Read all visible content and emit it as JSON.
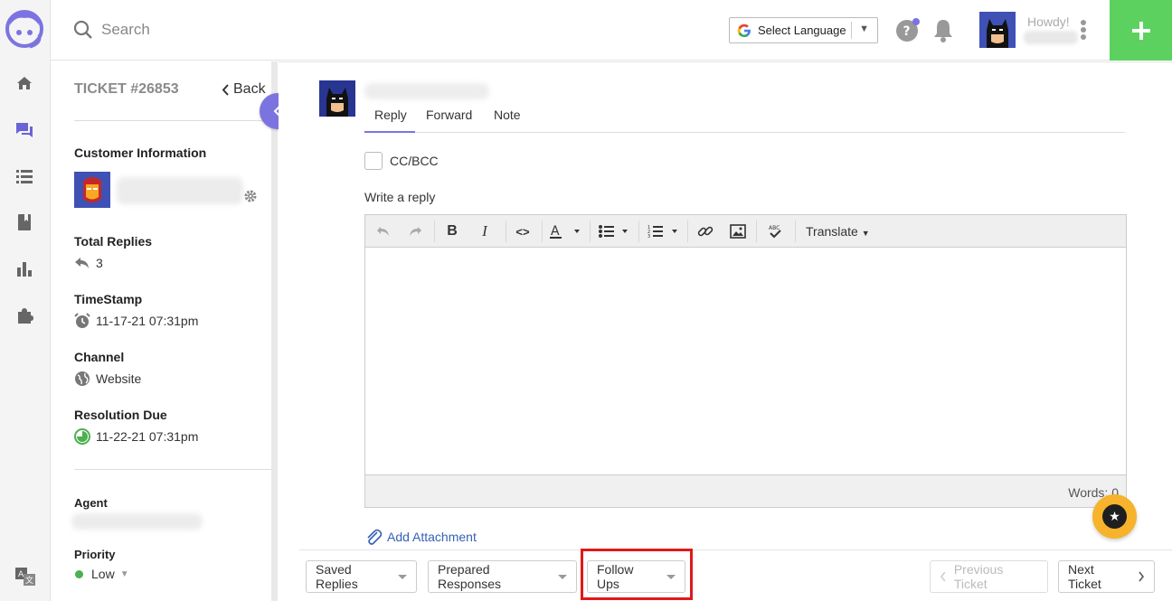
{
  "topbar": {
    "search_placeholder": "Search",
    "language_select": "Select Language",
    "greeting": "Howdy!"
  },
  "ticket": {
    "title": "TICKET #26853",
    "back_label": "Back",
    "customer_info_label": "Customer Information",
    "total_replies_label": "Total Replies",
    "total_replies_value": "3",
    "timestamp_label": "TimeStamp",
    "timestamp_value": "11-17-21 07:31pm",
    "channel_label": "Channel",
    "channel_value": "Website",
    "resolution_label": "Resolution Due",
    "resolution_value": "11-22-21 07:31pm",
    "agent_label": "Agent",
    "priority_label": "Priority",
    "priority_value": "Low"
  },
  "reply": {
    "tabs": [
      "Reply",
      "Forward",
      "Note"
    ],
    "active_tab": "Reply",
    "cc_bcc_label": "CC/BCC",
    "write_label": "Write a reply",
    "translate_label": "Translate",
    "words_label": "Words: 0",
    "add_attachment_label": "Add Attachment"
  },
  "bottom": {
    "saved_replies": "Saved Replies",
    "prepared_responses": "Prepared Responses",
    "follow_ups": "Follow Ups",
    "previous_ticket": "Previous Ticket",
    "next_ticket": "Next Ticket"
  },
  "colors": {
    "accent": "#7b74e0",
    "add_button": "#5cd15f",
    "fab": "#f6b32b",
    "priority_dot": "#4caf50",
    "highlight": "#e01818"
  },
  "icons": {
    "rail": [
      "home-icon",
      "chat-icon",
      "list-icon",
      "book-icon",
      "chart-icon",
      "puzzle-icon",
      "translate-icon"
    ]
  }
}
